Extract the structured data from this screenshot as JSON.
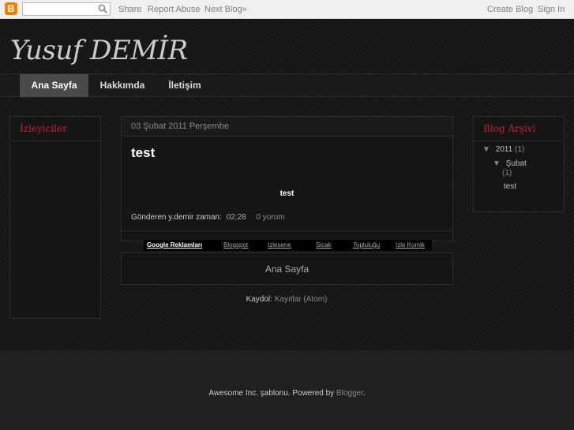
{
  "navbar": {
    "logo_letter": "B",
    "search_placeholder": "",
    "share": "Share",
    "report_abuse": "Report Abuse",
    "next_blog": "Next Blog»",
    "create_blog": "Create Blog",
    "sign_in": "Sign In"
  },
  "header": {
    "title": "Yusuf DEMİR"
  },
  "tabs": [
    {
      "label": "Ana Sayfa",
      "active": true
    },
    {
      "label": "Hakkımda",
      "active": false
    },
    {
      "label": "İletişim",
      "active": false
    }
  ],
  "left_widget": {
    "title": "İzleyiciler"
  },
  "post": {
    "date": "03 Şubat 2011 Perşembe",
    "title": "test",
    "body": "test",
    "posted_by": "Gönderen y.demir zaman:",
    "time": "02:28",
    "comments": "0 yorum"
  },
  "ads": {
    "title": "Google Reklamları",
    "links": [
      "Blogspot",
      "Izlesene",
      "Sicak",
      "Topluluğu",
      "Izle Komik"
    ]
  },
  "home_link": "Ana Sayfa",
  "subscribe": {
    "label": "Kaydol:",
    "link": "Kayıtlar (Atom)"
  },
  "archive": {
    "title": "Blog Arşivi",
    "year": "2011",
    "year_count": "(1)",
    "month": "Şubat",
    "month_count": "(1)",
    "post": "test",
    "expand_glyph": "▼"
  },
  "footer": {
    "text": "Awesome Inc. şablonu. Powered by",
    "link": "Blogger",
    "end": "."
  },
  "colors": {
    "widget_title": "#c4232d",
    "navbar_bg": "#f0f0f0",
    "logo": "#f57d00"
  }
}
